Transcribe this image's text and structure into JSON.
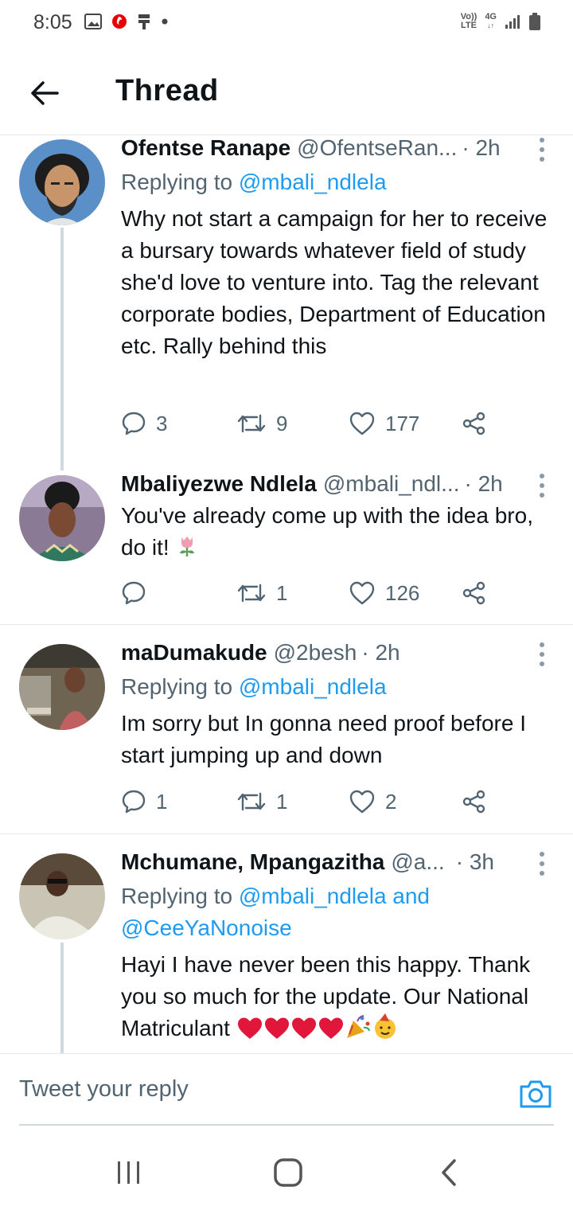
{
  "status_bar": {
    "time": "8:05",
    "lte_top": "Vo))",
    "lte_bottom": "LTE",
    "network": "4G"
  },
  "header": {
    "title": "Thread"
  },
  "tweets": [
    {
      "name": "Ofentse Ranape",
      "handle": "@OfentseRan...",
      "time": "· 2h",
      "replying_prefix": "Replying to",
      "replying_to": "@mbali_ndlela",
      "text": "Why not start a campaign for her to receive a bursary towards whatever field of study she'd love to venture into. Tag the relevant corporate bodies, Department of Education etc. Rally behind this",
      "replies": "3",
      "retweets": "9",
      "likes": "177"
    },
    {
      "name": "Mbaliyezwe Ndlela",
      "handle": "@mbali_ndl...",
      "time": "· 2h",
      "text": "You've already come up with the idea bro, do it!",
      "replies": "",
      "retweets": "1",
      "likes": "126"
    },
    {
      "name": "maDumakude",
      "handle": "@2besh",
      "time": "· 2h",
      "replying_prefix": "Replying to",
      "replying_to": "@mbali_ndlela",
      "text": "Im sorry but In gonna need proof before I start jumping up and down",
      "replies": "1",
      "retweets": "1",
      "likes": "2"
    },
    {
      "name": "Mchumane, Mpangazitha",
      "handle": "@a...",
      "time": "· 3h",
      "replying_prefix": "Replying to",
      "replying_to": "@mbali_ndlela and",
      "replying_to_2": "@CeeYaNonoise",
      "text": "Hayi I have never been this happy. Thank you so much for the update. Our National Matriculant"
    }
  ],
  "reply": {
    "placeholder": "Tweet your reply"
  },
  "colors": {
    "accent": "#1d9bf0",
    "text": "#0f1419",
    "secondary": "#536471",
    "divider": "#e6e9ec"
  }
}
